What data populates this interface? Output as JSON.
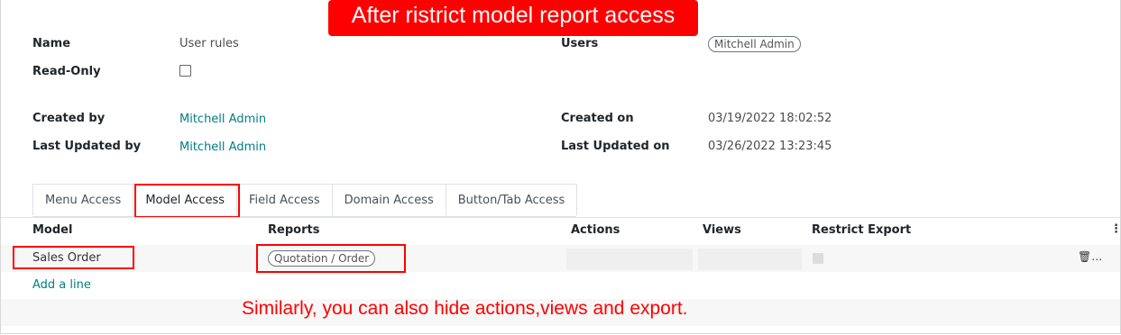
{
  "annotations": {
    "top": "After ristrict model report access",
    "bottom": "Similarly, you can also hide actions,views and export."
  },
  "form": {
    "name_label": "Name",
    "name_value": "User rules",
    "readonly_label": "Read-Only",
    "readonly_checked": false,
    "users_label": "Users",
    "users_tag": "Mitchell Admin",
    "created_by_label": "Created by",
    "created_by_value": "Mitchell Admin",
    "updated_by_label": "Last Updated by",
    "updated_by_value": "Mitchell Admin",
    "created_on_label": "Created on",
    "created_on_value": "03/19/2022 18:02:52",
    "updated_on_label": "Last Updated on",
    "updated_on_value": "03/26/2022 13:23:45"
  },
  "tabs": [
    {
      "label": "Menu Access"
    },
    {
      "label": "Model Access",
      "active": true
    },
    {
      "label": "Field Access"
    },
    {
      "label": "Domain Access"
    },
    {
      "label": "Button/Tab Access"
    }
  ],
  "table": {
    "headers": {
      "model": "Model",
      "reports": "Reports",
      "actions": "Actions",
      "views": "Views",
      "restrict_export": "Restrict Export"
    },
    "rows": [
      {
        "model": "Sales Order",
        "report_tag": "Quotation / Order",
        "restrict_export": false
      }
    ],
    "row_action_icon": "trash-icon",
    "row_action_ellipsis": "…",
    "add_line": "Add a line"
  },
  "icons": {
    "kebab": "⋮",
    "trash": "🗑"
  },
  "colors": {
    "annotation_red": "#ff0000",
    "link_teal": "#017e84"
  }
}
